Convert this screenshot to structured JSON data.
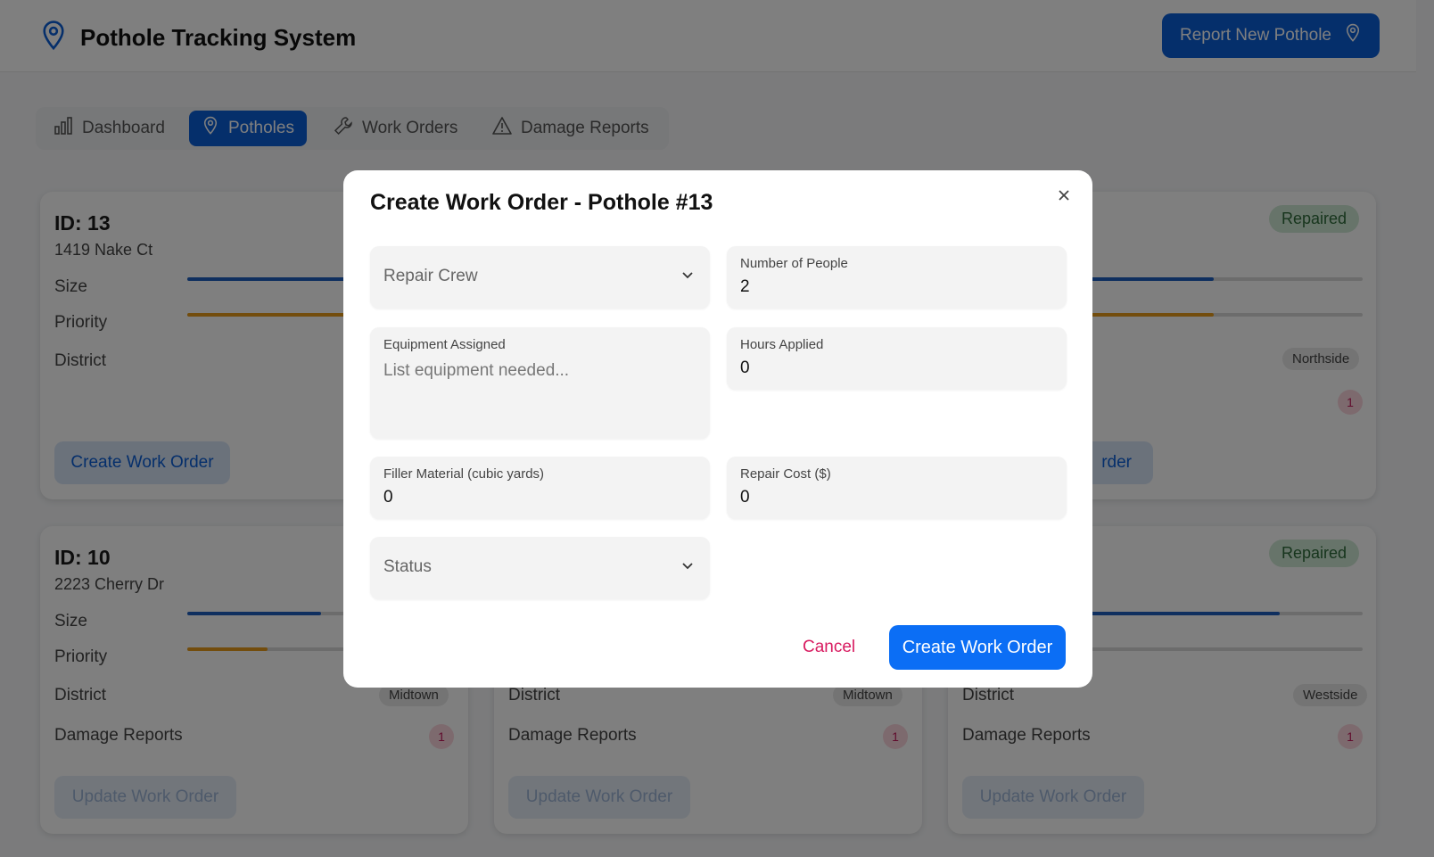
{
  "app": {
    "title": "Pothole Tracking System",
    "report_button": "Report New Pothole"
  },
  "tabs": [
    {
      "label": "Dashboard",
      "icon": "bar-chart-icon"
    },
    {
      "label": "Potholes",
      "icon": "map-pin-icon",
      "active": true
    },
    {
      "label": "Work Orders",
      "icon": "wrench-icon"
    },
    {
      "label": "Damage Reports",
      "icon": "warning-icon"
    }
  ],
  "cards": [
    {
      "id": "ID: 13",
      "address": "1419 Nake Ct",
      "size_label": "Size",
      "priority_label": "Priority",
      "district_label": "District",
      "button": "Create Work Order"
    },
    {
      "status": "Repaired",
      "district": "Northside",
      "damage_count": "1",
      "button_fragment": "rder"
    },
    {
      "id": "ID: 10",
      "address": "2223 Cherry Dr",
      "size_label": "Size",
      "priority_label": "Priority",
      "district_label": "District",
      "district": "Midtown",
      "damage_label": "Damage Reports",
      "damage_count": "1",
      "button": "Update Work Order",
      "size_level": 0.5,
      "priority_level": 0.3
    },
    {
      "district_label": "District",
      "district": "Midtown",
      "damage_label": "Damage Reports",
      "damage_count": "1",
      "button": "Update Work Order"
    },
    {
      "status": "Repaired",
      "district_label": "District",
      "district": "Westside",
      "damage_label": "Damage Reports",
      "damage_count": "1",
      "button": "Update Work Order"
    }
  ],
  "modal": {
    "title": "Create Work Order - Pothole #13",
    "close_icon": "close-icon",
    "repair_crew_placeholder": "Repair Crew",
    "people_label": "Number of People",
    "people_value": "2",
    "equipment_label": "Equipment Assigned",
    "equipment_placeholder": "List equipment needed...",
    "hours_label": "Hours Applied",
    "hours_value": "0",
    "filler_label": "Filler Material (cubic yards)",
    "filler_value": "0",
    "cost_label": "Repair Cost ($)",
    "cost_value": "0",
    "status_placeholder": "Status",
    "cancel": "Cancel",
    "create": "Create Work Order"
  },
  "colors": {
    "primary": "#0b5ed7",
    "size_bar": "#1f5fbf",
    "priority_bar": "#e69a1a",
    "cancel": "#d81b60"
  }
}
